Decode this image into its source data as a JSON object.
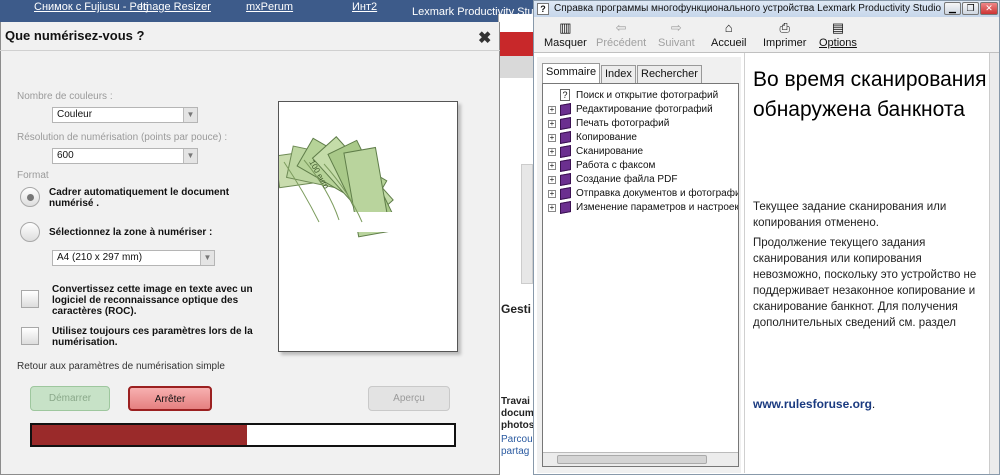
{
  "background": {
    "taskbar_items": [
      "Снимок с Fujiusu - Petj",
      "Image Resizer",
      "mxPerum",
      "Инт2",
      "Lexmark Productivity Studio"
    ],
    "right_side_texts": [
      "Gesti",
      "Travai",
      "docum",
      "photos",
      "Parcou",
      "partag"
    ]
  },
  "scan_dialog": {
    "title": "Que numérisez-vous ?",
    "close_glyph": "✖",
    "color_label": "Nombre de couleurs :",
    "color_value": "Couleur",
    "resolution_label": "Résolution de numérisation (points par pouce) :",
    "resolution_value": "600",
    "format_label": "Format",
    "option_auto_crop": "Cadrer automatiquement le document numérisé .",
    "option_select_area": "Sélectionnez la zone à numériser :",
    "area_value": "A4 (210 x 297 mm)",
    "ocr_option": "Convertissez cette image en texte avec un logiciel de reconnaissance optique des caractères (ROC).",
    "remember_option": "Utilisez toujours ces paramètres lors de la numérisation.",
    "simple_link": "Retour aux paramètres de numérisation simple",
    "start_button": "Démarrer",
    "stop_button": "Arrêter",
    "preview_button": "Aperçu",
    "progress_percent": 51,
    "preview_caption": "100 euro"
  },
  "help_window": {
    "title": "Справка программы многофункционального устройства Lexmark Productivity Studio",
    "toolbar": {
      "hide": "Masquer",
      "back": "Précédent",
      "forward": "Suivant",
      "home": "Accueil",
      "print": "Imprimer",
      "options": "Options"
    },
    "tabs": [
      "Sommaire",
      "Index",
      "Rechercher"
    ],
    "tree_items": [
      "Поиск и открытие фотографий",
      "Редактирование фотографий",
      "Печать фотографий",
      "Копирование",
      "Сканирование",
      "Работа с факсом",
      "Создание файла PDF",
      "Отправка документов и фотографий",
      "Изменение параметров и настроек"
    ],
    "content": {
      "heading": "Во время сканирования обнаружена банкнота",
      "paragraph1": "Текущее задание сканирования или копирования отменено.",
      "paragraph2": "Продолжение текущего задания сканирования или копирования невозможно, поскольку это устройство не поддерживает незаконное копирование и сканирование банкнот. Для получения дополнительных сведений см. раздел",
      "link": "www.rulesforuse.org",
      "link_suffix": "."
    }
  }
}
